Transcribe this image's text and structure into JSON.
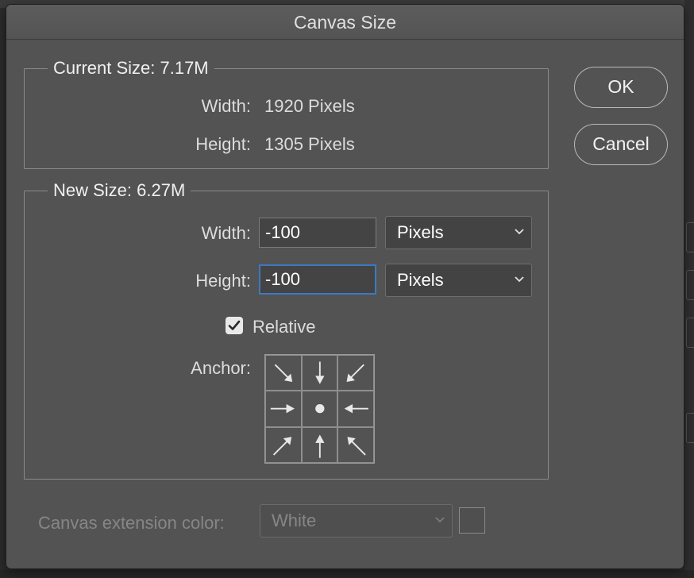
{
  "dialog": {
    "title": "Canvas Size"
  },
  "current_size": {
    "legend": "Current Size: 7.17M",
    "width_label": "Width:",
    "width_value": "1920 Pixels",
    "height_label": "Height:",
    "height_value": "1305 Pixels"
  },
  "new_size": {
    "legend": "New Size: 6.27M",
    "width_label": "Width:",
    "width_value": "-100",
    "width_unit": "Pixels",
    "height_label": "Height:",
    "height_value": "-100",
    "height_unit": "Pixels",
    "relative_label": "Relative",
    "relative_checked": true,
    "anchor_label": "Anchor:",
    "anchor_selected": "center",
    "anchor_icons": [
      "arrow-down-right-icon",
      "arrow-down-icon",
      "arrow-down-left-icon",
      "arrow-right-icon",
      "dot-icon",
      "arrow-left-icon",
      "arrow-up-right-icon",
      "arrow-up-icon",
      "arrow-up-left-icon"
    ]
  },
  "buttons": {
    "ok": "OK",
    "cancel": "Cancel"
  },
  "extension": {
    "label": "Canvas extension color:",
    "value": "White",
    "disabled": true
  },
  "colors": {
    "focus_ring": "#3d78c4",
    "dialog_bg": "#535353"
  }
}
